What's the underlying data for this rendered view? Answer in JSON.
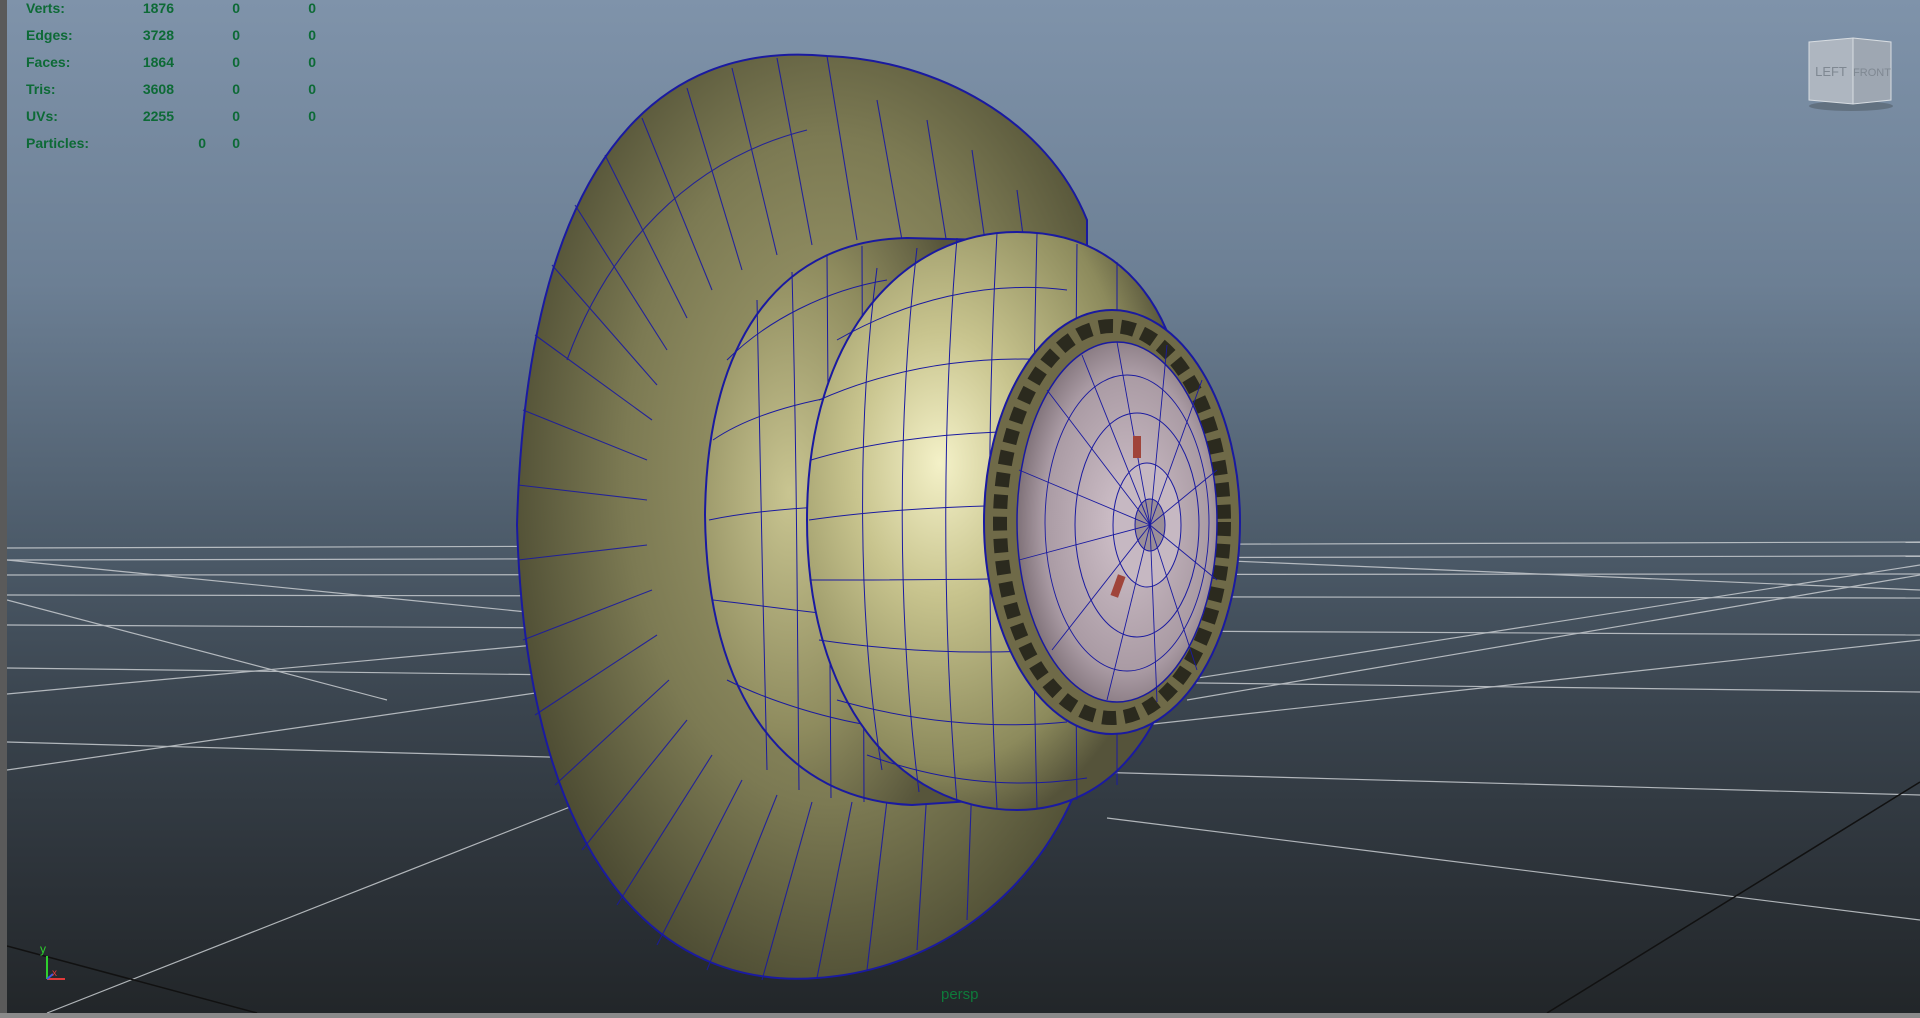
{
  "hud": {
    "rows": [
      {
        "label": "Verts:",
        "v1": "1876",
        "v2": "0",
        "v3": "0"
      },
      {
        "label": "Edges:",
        "v1": "3728",
        "v2": "0",
        "v3": "0"
      },
      {
        "label": "Faces:",
        "v1": "1864",
        "v2": "0",
        "v3": "0"
      },
      {
        "label": "Tris:",
        "v1": "3608",
        "v2": "0",
        "v3": "0"
      },
      {
        "label": "UVs:",
        "v1": "2255",
        "v2": "0",
        "v3": "0"
      }
    ],
    "particles": {
      "label": "Particles:",
      "v1": "0",
      "v2": "0"
    }
  },
  "view_cube": {
    "left_label": "LEFT",
    "front_label": "FRONT"
  },
  "camera": {
    "name": "persp"
  },
  "axis": {
    "y": "y",
    "x": "x"
  },
  "colors": {
    "hud_text": "#0d6a36",
    "wireframe": "#1a1aa0",
    "mesh_olive": "#b4b07a",
    "mesh_dark": "#5e5c3c",
    "inner_lavender": "#b7a4b0",
    "grid_line": "#c8ccd0"
  }
}
